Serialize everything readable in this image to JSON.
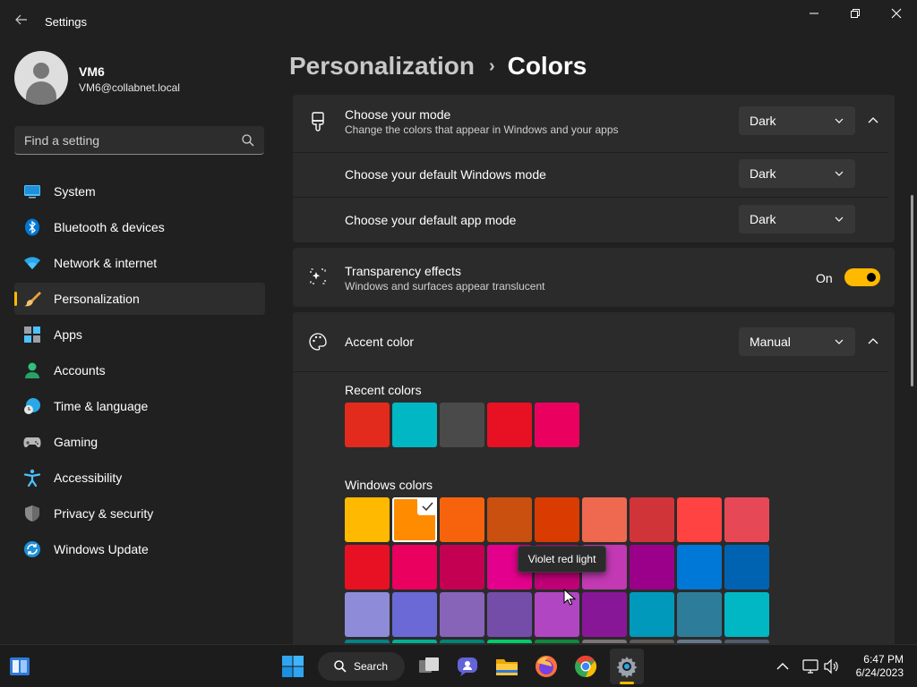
{
  "window": {
    "title": "Settings",
    "back_icon": "arrow-left-icon",
    "minimize_icon": "minimize-icon",
    "maximize_icon": "restore-icon",
    "close_icon": "close-icon"
  },
  "profile": {
    "name": "VM6",
    "email": "VM6@collabnet.local"
  },
  "search": {
    "placeholder": "Find a setting",
    "icon": "search-icon"
  },
  "sidebar": {
    "items": [
      {
        "label": "System",
        "icon": "system-monitor-icon",
        "active": false
      },
      {
        "label": "Bluetooth & devices",
        "icon": "bluetooth-icon",
        "active": false
      },
      {
        "label": "Network & internet",
        "icon": "wifi-icon",
        "active": false
      },
      {
        "label": "Personalization",
        "icon": "paintbrush-icon",
        "active": true
      },
      {
        "label": "Apps",
        "icon": "apps-icon",
        "active": false
      },
      {
        "label": "Accounts",
        "icon": "person-icon",
        "active": false
      },
      {
        "label": "Time & language",
        "icon": "globe-clock-icon",
        "active": false
      },
      {
        "label": "Gaming",
        "icon": "gamepad-icon",
        "active": false
      },
      {
        "label": "Accessibility",
        "icon": "accessibility-icon",
        "active": false
      },
      {
        "label": "Privacy & security",
        "icon": "shield-icon",
        "active": false
      },
      {
        "label": "Windows Update",
        "icon": "windows-update-icon",
        "active": false
      }
    ]
  },
  "breadcrumb": {
    "parent": "Personalization",
    "separator": "›",
    "current": "Colors"
  },
  "mode": {
    "title": "Choose your mode",
    "subtitle": "Change the colors that appear in Windows and your apps",
    "value": "Dark",
    "icon": "paint-brush-icon",
    "expanded": true,
    "windows_mode": {
      "label": "Choose your default Windows mode",
      "value": "Dark"
    },
    "app_mode": {
      "label": "Choose your default app mode",
      "value": "Dark"
    }
  },
  "transparency": {
    "title": "Transparency effects",
    "subtitle": "Windows and surfaces appear translucent",
    "state_label": "On",
    "on": true,
    "icon": "transparency-sparkle-icon"
  },
  "accent": {
    "title": "Accent color",
    "value": "Manual",
    "icon": "palette-icon",
    "expanded": true,
    "recent_label": "Recent colors",
    "recent_colors": [
      "#e22b1d",
      "#00b7c3",
      "#4a4a4a",
      "#e81123",
      "#ea005e"
    ],
    "windows_label": "Windows colors",
    "windows_colors": [
      [
        "#ffb900",
        "#ff8c00",
        "#f7630c",
        "#ca5010",
        "#da3b01",
        "#ef6950",
        "#d13438",
        "#ff4343",
        "#e74856"
      ],
      [
        "#e81123",
        "#ea005e",
        "#c30052",
        "#e3008c",
        "#bf0077",
        "#c239b3",
        "#9a0089",
        "#0078d7",
        "#0063b1"
      ],
      [
        "#8e8cd8",
        "#6b69d6",
        "#8764b8",
        "#744da9",
        "#b146c2",
        "#881798",
        "#0099bc",
        "#2d7d9a",
        "#00b7c3"
      ],
      [
        "#038387",
        "#00b294",
        "#018574",
        "#00cc6a",
        "#10893e",
        "#7a7574",
        "#5d5a58",
        "#68768a",
        "#515c6b"
      ]
    ],
    "selected_color": "#ff8c00",
    "check_icon": "checkmark-icon",
    "tooltip": "Violet red light"
  },
  "taskbar": {
    "search_label": "Search",
    "apps": [
      "widgets-icon",
      "windows-start-icon",
      "task-view-icon",
      "chat-icon",
      "file-explorer-icon",
      "firefox-icon",
      "chrome-icon",
      "settings-gear-icon"
    ],
    "tray_icons": [
      "chevron-up-icon",
      "network-icon",
      "volume-icon"
    ],
    "time": "6:47 PM",
    "date": "6/24/2023"
  }
}
